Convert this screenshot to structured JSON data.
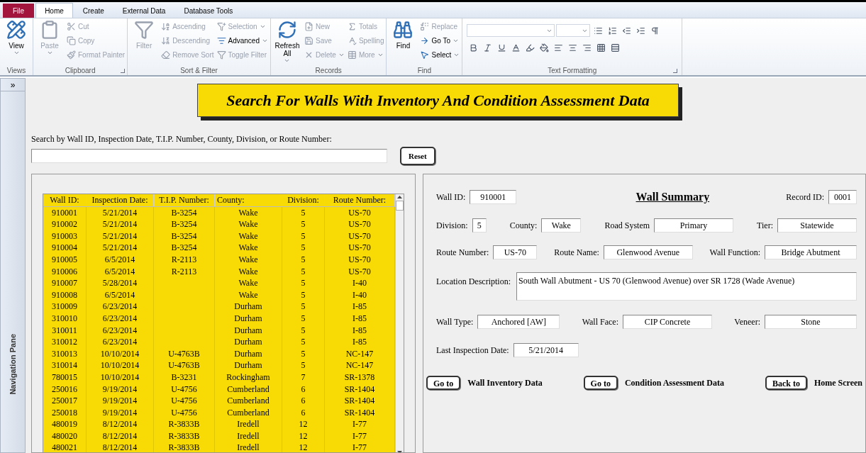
{
  "ribbon": {
    "tabs": [
      {
        "label": "File",
        "kind": "file",
        "selected": false
      },
      {
        "label": "Home",
        "kind": "tab",
        "selected": true
      },
      {
        "label": "Create",
        "kind": "tab",
        "selected": false
      },
      {
        "label": "External Data",
        "kind": "tab",
        "selected": false
      },
      {
        "label": "Database Tools",
        "kind": "tab",
        "selected": false
      }
    ],
    "groups": [
      {
        "label": "Views",
        "launcher": false,
        "big": [
          {
            "label": "View",
            "disabled": false,
            "dropdown": true
          }
        ]
      },
      {
        "label": "Clipboard",
        "launcher": true,
        "big": [
          {
            "label": "Paste",
            "disabled": true,
            "dropdown": true
          }
        ],
        "columns": [
          [
            {
              "label": "Cut",
              "disabled": true,
              "dropdown": false
            },
            {
              "label": "Copy",
              "disabled": true,
              "dropdown": false
            },
            {
              "label": "Format Painter",
              "disabled": true,
              "dropdown": false
            }
          ]
        ]
      },
      {
        "label": "Sort & Filter",
        "launcher": false,
        "big": [
          {
            "label": "Filter",
            "disabled": true,
            "dropdown": false
          }
        ],
        "columns": [
          [
            {
              "label": "Ascending",
              "disabled": true,
              "dropdown": false
            },
            {
              "label": "Descending",
              "disabled": true,
              "dropdown": false
            },
            {
              "label": "Remove Sort",
              "disabled": true,
              "dropdown": false
            }
          ],
          [
            {
              "label": "Selection",
              "disabled": true,
              "dropdown": true
            },
            {
              "label": "Advanced",
              "disabled": false,
              "dropdown": true
            },
            {
              "label": "Toggle Filter",
              "disabled": true,
              "dropdown": false
            }
          ]
        ]
      },
      {
        "label": "Records",
        "launcher": false,
        "big": [
          {
            "label": "Refresh All",
            "disabled": false,
            "dropdown": true
          }
        ],
        "columns": [
          [
            {
              "label": "New",
              "disabled": true,
              "dropdown": false
            },
            {
              "label": "Save",
              "disabled": true,
              "dropdown": false
            },
            {
              "label": "Delete",
              "disabled": true,
              "dropdown": true
            }
          ],
          [
            {
              "label": "Totals",
              "disabled": true,
              "dropdown": false
            },
            {
              "label": "Spelling",
              "disabled": true,
              "dropdown": false
            },
            {
              "label": "More",
              "disabled": true,
              "dropdown": true
            }
          ]
        ]
      },
      {
        "label": "Find",
        "launcher": false,
        "big": [
          {
            "label": "Find",
            "disabled": false,
            "dropdown": false
          }
        ],
        "columns": [
          [
            {
              "label": "Replace",
              "disabled": true,
              "dropdown": false
            },
            {
              "label": "Go To",
              "disabled": false,
              "dropdown": true
            },
            {
              "label": "Select",
              "disabled": false,
              "dropdown": true
            }
          ]
        ]
      }
    ],
    "text_formatting": {
      "label": "Text Formatting",
      "launcher": true
    }
  },
  "nav_pane": {
    "toggle": "»",
    "label": "Navigation Pane"
  },
  "banner": "Search For Walls With Inventory And Condition Assessment Data",
  "search": {
    "label": "Search by Wall ID, Inspection Date, T.I.P. Number, County, Division, or Route Number:",
    "reset": "Reset"
  },
  "table": {
    "columns": [
      "Wall ID:",
      "Inspection Date:",
      "T.I.P. Number:",
      "County:",
      "Division:",
      "Route Number:"
    ],
    "rows": [
      [
        "910001",
        "5/21/2014",
        "B-3254",
        "Wake",
        "5",
        "US-70"
      ],
      [
        "910002",
        "5/21/2014",
        "B-3254",
        "Wake",
        "5",
        "US-70"
      ],
      [
        "910003",
        "5/21/2014",
        "B-3254",
        "Wake",
        "5",
        "US-70"
      ],
      [
        "910004",
        "5/21/2014",
        "B-3254",
        "Wake",
        "5",
        "US-70"
      ],
      [
        "910005",
        "6/5/2014",
        "R-2113",
        "Wake",
        "5",
        "US-70"
      ],
      [
        "910006",
        "6/5/2014",
        "R-2113",
        "Wake",
        "5",
        "US-70"
      ],
      [
        "910007",
        "5/28/2014",
        "",
        "Wake",
        "5",
        "I-40"
      ],
      [
        "910008",
        "6/5/2014",
        "",
        "Wake",
        "5",
        "I-40"
      ],
      [
        "310009",
        "6/23/2014",
        "",
        "Durham",
        "5",
        "I-85"
      ],
      [
        "310010",
        "6/23/2014",
        "",
        "Durham",
        "5",
        "I-85"
      ],
      [
        "310011",
        "6/23/2014",
        "",
        "Durham",
        "5",
        "I-85"
      ],
      [
        "310012",
        "6/23/2014",
        "",
        "Durham",
        "5",
        "I-85"
      ],
      [
        "310013",
        "10/10/2014",
        "U-4763B",
        "Durham",
        "5",
        "NC-147"
      ],
      [
        "310014",
        "10/10/2014",
        "U-4763B",
        "Durham",
        "5",
        "NC-147"
      ],
      [
        "780015",
        "10/10/2014",
        "B-3231",
        "Rockingham",
        "7",
        "SR-1378"
      ],
      [
        "250016",
        "9/19/2014",
        "U-4756",
        "Cumberland",
        "6",
        "SR-1404"
      ],
      [
        "250017",
        "9/19/2014",
        "U-4756",
        "Cumberland",
        "6",
        "SR-1404"
      ],
      [
        "250018",
        "9/19/2014",
        "U-4756",
        "Cumberland",
        "6",
        "SR-1404"
      ],
      [
        "480019",
        "8/12/2014",
        "R-3833B",
        "Iredell",
        "12",
        "I-77"
      ],
      [
        "480020",
        "8/12/2014",
        "R-3833B",
        "Iredell",
        "12",
        "I-77"
      ],
      [
        "480021",
        "8/12/2014",
        "R-3833B",
        "Iredell",
        "12",
        "I-77"
      ]
    ]
  },
  "summary": {
    "title": "Wall Summary",
    "wall_id": {
      "label": "Wall ID:",
      "value": "910001"
    },
    "record_id": {
      "label": "Record ID:",
      "value": "0001"
    },
    "rows": [
      {
        "fields": [
          {
            "label": "Division:",
            "value": "5"
          },
          {
            "label": "County:",
            "value": "Wake"
          },
          {
            "label": "Road System",
            "value": "Primary"
          },
          {
            "label": "Tier:",
            "value": "Statewide"
          }
        ]
      },
      {
        "fields": [
          {
            "label": "Route Number:",
            "value": "US-70"
          },
          {
            "label": "Route Name:",
            "value": "Glenwood Avenue"
          },
          {
            "label": "Wall Function:",
            "value": "Bridge Abutment"
          }
        ]
      }
    ],
    "location": {
      "label": "Location Description:",
      "value": "South Wall Abutment - US 70 (Glenwood Avenue) over SR 1728 (Wade Avenue)"
    },
    "rows2": [
      {
        "fields": [
          {
            "label": "Wall Type:",
            "value": "Anchored [AW]"
          },
          {
            "label": "Wall Face:",
            "value": "CIP Concrete"
          },
          {
            "label": "Veneer:",
            "value": "Stone"
          }
        ]
      },
      {
        "fields": [
          {
            "label": "Last Inspection Date:",
            "value": "5/21/2014"
          }
        ]
      }
    ],
    "actions": [
      {
        "button": "Go to",
        "label": "Wall Inventory Data"
      },
      {
        "button": "Go to",
        "label": "Condition Assessment Data"
      },
      {
        "button": "Back to",
        "label": "Home Screen"
      }
    ]
  }
}
